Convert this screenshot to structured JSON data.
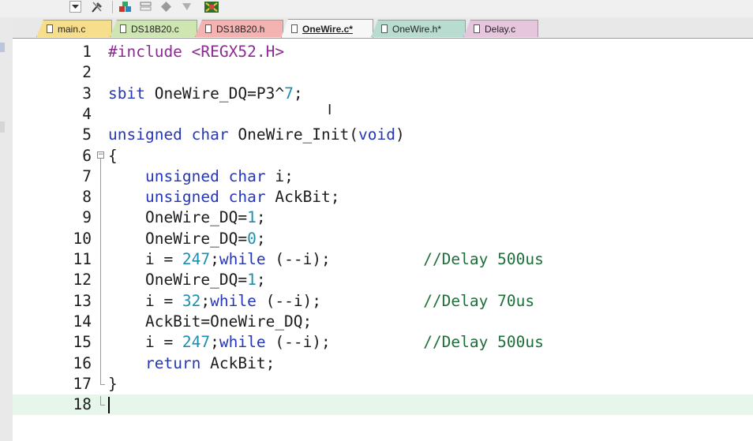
{
  "toolbar": {
    "icons": [
      "dropdown-arrow-icon",
      "wrench-icon",
      "build-icon",
      "batch-icon",
      "diamond-icon",
      "brush-icon",
      "packages-icon"
    ]
  },
  "tabs": [
    {
      "label": "main.c",
      "color": "#f6de8c",
      "active": false
    },
    {
      "label": "DS18B20.c",
      "color": "#cfe6b2",
      "active": false
    },
    {
      "label": "DS18B20.h",
      "color": "#f4b2b0",
      "active": false
    },
    {
      "label": "OneWire.c*",
      "color": "#f7f7f7",
      "active": true
    },
    {
      "label": "OneWire.h*",
      "color": "#b8dcd0",
      "active": false
    },
    {
      "label": "Delay.c",
      "color": "#e6c6dc",
      "active": false
    }
  ],
  "editor": {
    "lines": [
      {
        "num": "1",
        "code": "#include <REGX52.H>"
      },
      {
        "num": "2",
        "code": ""
      },
      {
        "num": "3",
        "code": "sbit OneWire_DQ=P3^7;"
      },
      {
        "num": "4",
        "code": ""
      },
      {
        "num": "5",
        "code": "unsigned char OneWire_Init(void)"
      },
      {
        "num": "6",
        "code": "{"
      },
      {
        "num": "7",
        "code": "    unsigned char i;"
      },
      {
        "num": "8",
        "code": "    unsigned char AckBit;"
      },
      {
        "num": "9",
        "code": "    OneWire_DQ=1;"
      },
      {
        "num": "10",
        "code": "    OneWire_DQ=0;"
      },
      {
        "num": "11",
        "code": "    i = 247;while (--i);          //Delay 500us"
      },
      {
        "num": "12",
        "code": "    OneWire_DQ=1;"
      },
      {
        "num": "13",
        "code": "    i = 32;while (--i);           //Delay 70us"
      },
      {
        "num": "14",
        "code": "    AckBit=OneWire_DQ;"
      },
      {
        "num": "15",
        "code": "    i = 247;while (--i);          //Delay 500us"
      },
      {
        "num": "16",
        "code": "    return AckBit;"
      },
      {
        "num": "17",
        "code": "}"
      },
      {
        "num": "18",
        "code": ""
      }
    ],
    "current_line": 18,
    "fold_toggle": "⊟"
  }
}
